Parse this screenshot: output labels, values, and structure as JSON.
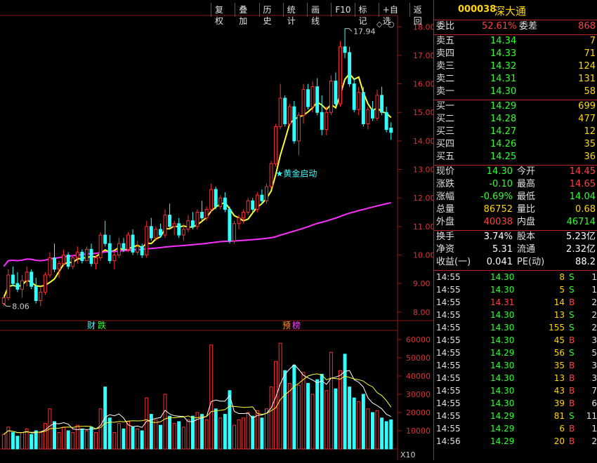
{
  "toolbar": {
    "items": [
      "复权",
      "叠加",
      "历史",
      "统计",
      "画线",
      "F10",
      "标记",
      "+自选",
      "返回"
    ]
  },
  "quote": {
    "code": "000038",
    "name": "深大通",
    "weibi_label": "委比",
    "weibi": "52.61%",
    "weicha_label": "委差",
    "weicha": "868",
    "asks": [
      {
        "label": "卖五",
        "price": "14.34",
        "vol": "7"
      },
      {
        "label": "卖四",
        "price": "14.33",
        "vol": "71"
      },
      {
        "label": "卖三",
        "price": "14.32",
        "vol": "124"
      },
      {
        "label": "卖二",
        "price": "14.31",
        "vol": "131"
      },
      {
        "label": "卖一",
        "price": "14.30",
        "vol": "58"
      }
    ],
    "bids": [
      {
        "label": "买一",
        "price": "14.29",
        "vol": "699"
      },
      {
        "label": "买二",
        "price": "14.28",
        "vol": "477"
      },
      {
        "label": "买三",
        "price": "14.27",
        "vol": "12"
      },
      {
        "label": "买四",
        "price": "14.26",
        "vol": "35"
      },
      {
        "label": "买五",
        "price": "14.25",
        "vol": "36"
      }
    ],
    "stats": [
      {
        "l1": "现价",
        "v1": "14.30",
        "c1": "green",
        "l2": "今开",
        "v2": "14.45",
        "c2": "red"
      },
      {
        "l1": "涨跌",
        "v1": "-0.10",
        "c1": "green",
        "l2": "最高",
        "v2": "14.65",
        "c2": "red"
      },
      {
        "l1": "涨幅",
        "v1": "-0.69%",
        "c1": "green",
        "l2": "最低",
        "v2": "14.04",
        "c2": "green"
      },
      {
        "l1": "总量",
        "v1": "86752",
        "c1": "yellow",
        "l2": "量比",
        "v2": "0.68",
        "c2": "yellow"
      },
      {
        "l1": "外盘",
        "v1": "40038",
        "c1": "red",
        "l2": "内盘",
        "v2": "46714",
        "c2": "green"
      }
    ],
    "stats2": [
      {
        "l1": "换手",
        "v1": "3.74%",
        "l2": "股本",
        "v2": "5.23亿"
      },
      {
        "l1": "净资",
        "v1": "5.31",
        "l2": "流通",
        "v2": "2.32亿"
      },
      {
        "l1": "收益(一)",
        "v1": "0.041",
        "l2": "PE(动)",
        "v2": "88.2"
      }
    ]
  },
  "trades": [
    {
      "time": "14:55",
      "price": "14.30",
      "pc": "green",
      "vol": "8",
      "side": "S",
      "n": "1"
    },
    {
      "time": "14:55",
      "price": "14.30",
      "pc": "green",
      "vol": "5",
      "side": "S",
      "n": "1"
    },
    {
      "time": "14:55",
      "price": "14.31",
      "pc": "red",
      "vol": "14",
      "side": "B",
      "n": "2"
    },
    {
      "time": "14:55",
      "price": "14.30",
      "pc": "green",
      "vol": "13",
      "side": "S",
      "n": "2"
    },
    {
      "time": "14:55",
      "price": "14.30",
      "pc": "green",
      "vol": "155",
      "side": "S",
      "n": "2"
    },
    {
      "time": "14:55",
      "price": "14.30",
      "pc": "green",
      "vol": "45",
      "side": "B",
      "n": "3"
    },
    {
      "time": "14:55",
      "price": "14.29",
      "pc": "green",
      "vol": "56",
      "side": "S",
      "n": "5"
    },
    {
      "time": "14:55",
      "price": "14.30",
      "pc": "green",
      "vol": "35",
      "side": "B",
      "n": "3"
    },
    {
      "time": "14:55",
      "price": "14.30",
      "pc": "green",
      "vol": "13",
      "side": "B",
      "n": "3"
    },
    {
      "time": "14:55",
      "price": "14.30",
      "pc": "green",
      "vol": "43",
      "side": "B",
      "n": "7"
    },
    {
      "time": "14:55",
      "price": "14.30",
      "pc": "green",
      "vol": "39",
      "side": "B",
      "n": "6"
    },
    {
      "time": "14:55",
      "price": "14.29",
      "pc": "green",
      "vol": "81",
      "side": "S",
      "n": "11"
    },
    {
      "time": "14:55",
      "price": "14.29",
      "pc": "green",
      "vol": "6",
      "side": "B",
      "n": "1"
    },
    {
      "time": "14:56",
      "price": "14.29",
      "pc": "green",
      "vol": "20",
      "side": "B",
      "n": "2"
    }
  ],
  "chart_data": {
    "type": "candlestick",
    "price_axis": {
      "ticks": [
        "18.00",
        "17.00",
        "16.00",
        "15.00",
        "14.00",
        "13.00",
        "12.00",
        "11.00",
        "10.00",
        "9.00",
        "8.00"
      ],
      "range": [
        7.7,
        18.4
      ]
    },
    "volume_axis": {
      "ticks": [
        "60000",
        "50000",
        "40000",
        "30000",
        "20000",
        "10000"
      ],
      "unit": "X10",
      "range": [
        0,
        65000
      ]
    },
    "high_marker": "17.94",
    "low_marker": "8.06",
    "signal_label": "★黄金启动",
    "event_labels": [
      {
        "text": "财",
        "color": "#30ffff"
      },
      {
        "text": "跌",
        "color": "#30ff30"
      },
      {
        "text": "预",
        "color": "#ff9a2a"
      },
      {
        "text": "榜",
        "color": "#ff40ff"
      }
    ],
    "candles": [
      [
        8.3,
        8.6,
        8.2,
        8.5
      ],
      [
        8.5,
        9.5,
        8.4,
        9.3
      ],
      [
        9.3,
        9.6,
        8.9,
        9.0
      ],
      [
        9.0,
        9.4,
        8.7,
        8.8
      ],
      [
        8.8,
        9.3,
        8.5,
        9.1
      ],
      [
        9.1,
        9.6,
        8.9,
        9.4
      ],
      [
        9.4,
        9.5,
        8.8,
        8.9
      ],
      [
        8.9,
        9.2,
        8.3,
        8.4
      ],
      [
        8.4,
        8.9,
        8.2,
        8.7
      ],
      [
        8.7,
        9.4,
        8.6,
        9.3
      ],
      [
        9.3,
        10.1,
        9.2,
        9.9
      ],
      [
        9.9,
        10.4,
        9.4,
        9.5
      ],
      [
        9.5,
        9.8,
        9.2,
        9.7
      ],
      [
        9.7,
        10.2,
        9.6,
        10.0
      ],
      [
        10.0,
        10.1,
        9.5,
        9.6
      ],
      [
        9.6,
        10.0,
        9.5,
        9.9
      ],
      [
        9.9,
        10.3,
        9.7,
        10.1
      ],
      [
        10.1,
        10.2,
        9.7,
        9.8
      ],
      [
        9.8,
        10.3,
        9.8,
        10.2
      ],
      [
        10.2,
        10.4,
        9.6,
        9.7
      ],
      [
        9.7,
        10.0,
        9.5,
        9.9
      ],
      [
        9.9,
        10.8,
        9.8,
        10.7
      ],
      [
        10.7,
        11.2,
        10.3,
        10.4
      ],
      [
        10.4,
        10.7,
        9.7,
        9.8
      ],
      [
        9.8,
        10.1,
        9.5,
        10.0
      ],
      [
        10.0,
        10.6,
        9.9,
        10.4
      ],
      [
        10.4,
        10.6,
        10.1,
        10.2
      ],
      [
        10.2,
        10.8,
        10.1,
        10.7
      ],
      [
        10.7,
        10.9,
        10.0,
        10.1
      ],
      [
        10.1,
        10.5,
        10.0,
        10.3
      ],
      [
        10.3,
        10.4,
        9.9,
        10.0
      ],
      [
        10.0,
        11.2,
        9.9,
        11.0
      ],
      [
        11.0,
        11.3,
        10.5,
        10.6
      ],
      [
        10.6,
        11.0,
        10.5,
        10.9
      ],
      [
        10.9,
        11.1,
        10.6,
        10.7
      ],
      [
        10.7,
        11.6,
        10.6,
        11.4
      ],
      [
        11.4,
        11.8,
        10.9,
        11.0
      ],
      [
        11.0,
        11.2,
        10.7,
        11.1
      ],
      [
        11.1,
        11.3,
        10.6,
        10.7
      ],
      [
        10.7,
        11.1,
        10.5,
        10.9
      ],
      [
        10.9,
        11.4,
        10.8,
        11.2
      ],
      [
        11.2,
        11.5,
        10.9,
        11.0
      ],
      [
        11.0,
        11.6,
        10.9,
        11.5
      ],
      [
        11.5,
        11.9,
        11.2,
        11.3
      ],
      [
        11.3,
        11.7,
        11.2,
        11.6
      ],
      [
        11.6,
        12.5,
        11.5,
        12.3
      ],
      [
        12.3,
        12.4,
        11.6,
        11.7
      ],
      [
        11.7,
        12.1,
        11.6,
        12.0
      ],
      [
        12.0,
        12.2,
        11.5,
        11.6
      ],
      [
        11.6,
        11.7,
        10.4,
        10.5
      ],
      [
        10.5,
        11.2,
        10.4,
        11.1
      ],
      [
        11.1,
        11.4,
        10.9,
        11.3
      ],
      [
        11.3,
        11.6,
        11.1,
        11.5
      ],
      [
        11.5,
        12.0,
        11.4,
        11.9
      ],
      [
        11.9,
        12.0,
        11.5,
        11.6
      ],
      [
        11.6,
        12.2,
        11.5,
        12.1
      ],
      [
        12.1,
        12.3,
        11.8,
        11.9
      ],
      [
        11.9,
        12.5,
        11.8,
        12.4
      ],
      [
        12.4,
        13.3,
        12.3,
        13.2
      ],
      [
        13.2,
        14.6,
        13.1,
        14.5
      ],
      [
        14.5,
        16.0,
        14.4,
        15.5
      ],
      [
        15.5,
        15.6,
        14.5,
        14.6
      ],
      [
        14.6,
        15.3,
        14.5,
        15.2
      ],
      [
        15.2,
        15.4,
        13.9,
        14.0
      ],
      [
        14.0,
        15.0,
        13.5,
        14.9
      ],
      [
        14.9,
        16.0,
        14.6,
        15.8
      ],
      [
        15.8,
        16.0,
        15.1,
        15.2
      ],
      [
        15.2,
        16.1,
        15.0,
        15.9
      ],
      [
        15.9,
        16.2,
        14.9,
        15.0
      ],
      [
        15.0,
        15.6,
        14.2,
        14.4
      ],
      [
        14.4,
        15.2,
        14.2,
        15.0
      ],
      [
        15.0,
        16.3,
        14.9,
        16.1
      ],
      [
        16.1,
        16.4,
        15.2,
        15.3
      ],
      [
        15.3,
        17.5,
        15.2,
        17.3
      ],
      [
        17.3,
        17.94,
        16.9,
        17.1
      ],
      [
        17.1,
        17.3,
        15.9,
        16.0
      ],
      [
        16.0,
        16.2,
        15.0,
        15.1
      ],
      [
        15.1,
        15.9,
        14.9,
        15.7
      ],
      [
        15.7,
        15.9,
        14.5,
        14.6
      ],
      [
        14.6,
        15.2,
        14.4,
        15.1
      ],
      [
        15.1,
        15.4,
        14.7,
        14.8
      ],
      [
        14.8,
        15.8,
        14.7,
        15.6
      ],
      [
        15.6,
        15.9,
        14.9,
        15.0
      ],
      [
        15.0,
        15.2,
        14.3,
        14.4
      ],
      [
        14.45,
        14.65,
        14.04,
        14.3
      ]
    ],
    "volumes": [
      8000,
      12000,
      9000,
      7000,
      9000,
      11000,
      8000,
      10000,
      9000,
      14000,
      22000,
      15000,
      9000,
      12000,
      10000,
      9000,
      13000,
      11000,
      10000,
      12000,
      9000,
      22000,
      34000,
      17000,
      9000,
      14000,
      11000,
      15000,
      12000,
      11000,
      10000,
      28000,
      19000,
      16000,
      13000,
      30000,
      18000,
      14000,
      15000,
      12000,
      16000,
      18000,
      20000,
      19000,
      16000,
      57000,
      22000,
      17000,
      19000,
      32000,
      13000,
      16000,
      17000,
      20000,
      18000,
      21000,
      17000,
      22000,
      34000,
      48000,
      58000,
      43000,
      36000,
      46000,
      35000,
      42000,
      36000,
      30000,
      38000,
      41000,
      32000,
      53000,
      33000,
      43000,
      52000,
      34000,
      28000,
      26000,
      30000,
      22000,
      20000,
      21000,
      17000,
      15000,
      16000
    ]
  }
}
